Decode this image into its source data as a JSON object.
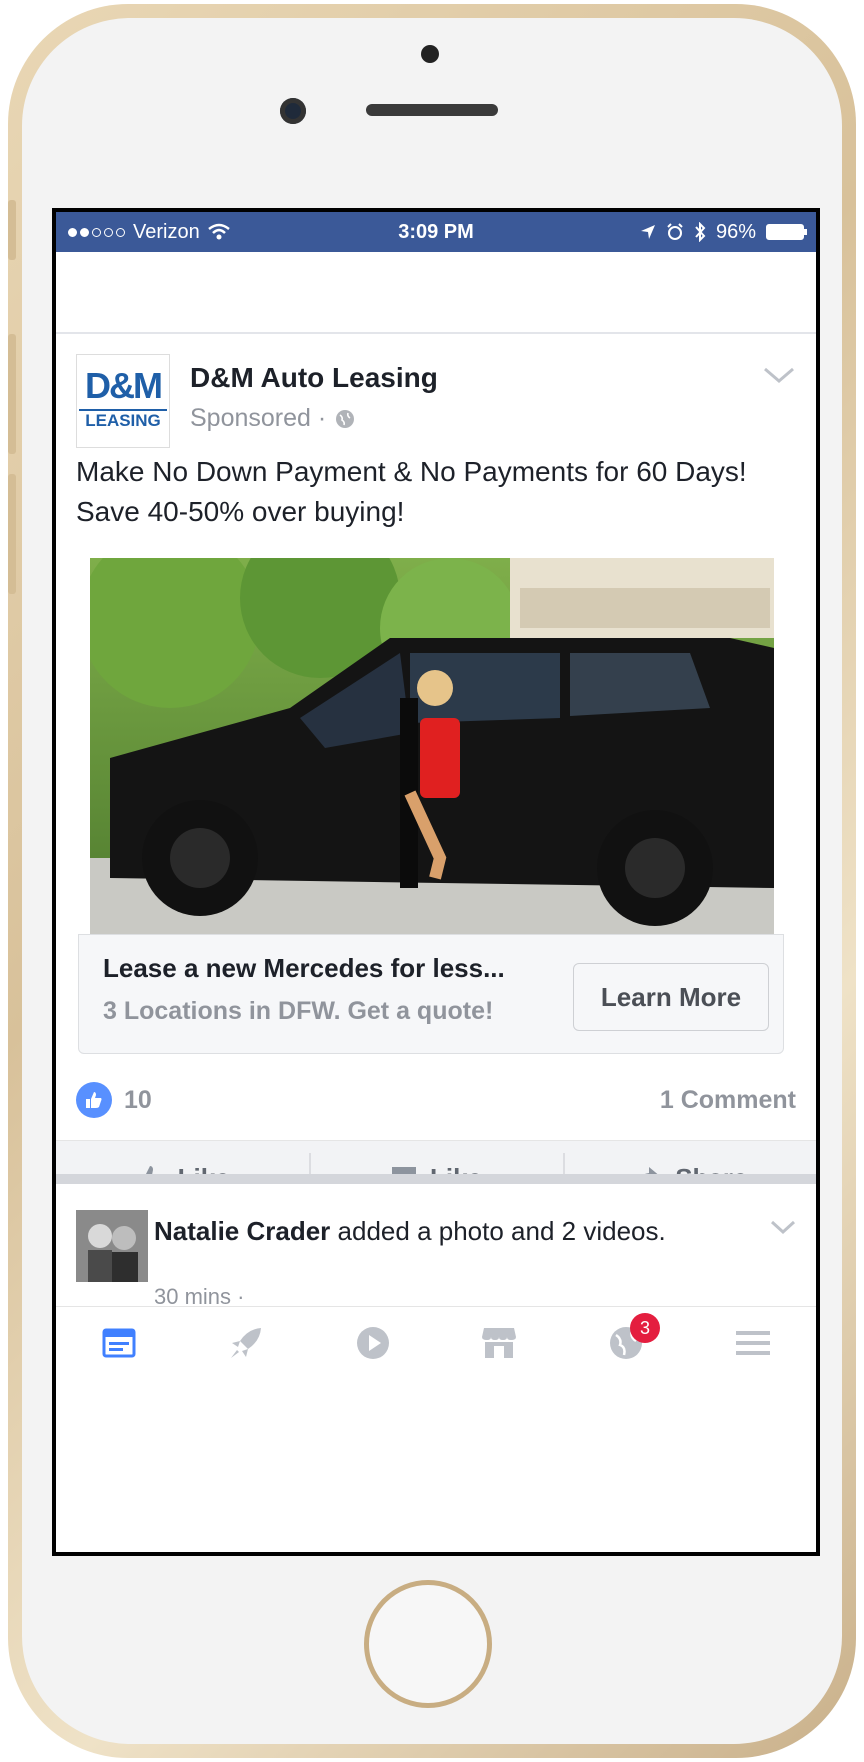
{
  "status_bar": {
    "carrier": "Verizon",
    "time": "3:09 PM",
    "battery": "96%"
  },
  "post": {
    "page_name": "D&M Auto Leasing",
    "sponsored": "Sponsored ·",
    "logo_top": "D&M",
    "logo_bottom": "LEASING",
    "text": "Make No Down Payment & No Payments for 60 Days! Save 40-50% over buying!",
    "ad_headline": "Lease a new Mercedes for less...",
    "ad_subline": "3 Locations in DFW. Get a quote!",
    "cta": "Learn More",
    "likes": "10",
    "comments": "1 Comment",
    "actions": [
      "Like",
      "Like",
      "Share"
    ]
  },
  "story": {
    "author": "Natalie Crader",
    "action": "added a photo and 2 videos.",
    "time": "30 mins ·"
  },
  "tabbar": {
    "notification_badge": "3"
  },
  "colors": {
    "brand": "#3b5998",
    "like_blue": "#5890ff",
    "badge_red": "#e41e3f"
  }
}
